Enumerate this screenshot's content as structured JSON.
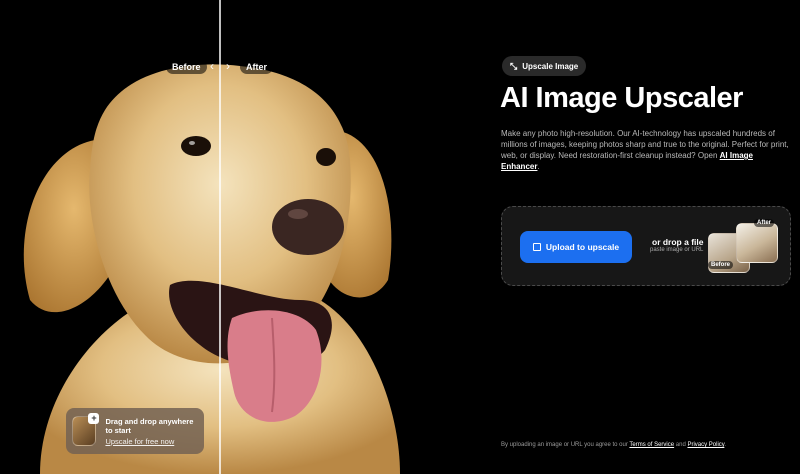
{
  "compare": {
    "before_label": "Before",
    "after_label": "After",
    "handle_left": "‹",
    "handle_right": "›"
  },
  "drop_card": {
    "title": "Drag and drop anywhere to start",
    "link": "Upscale for free now",
    "icon": "image-thumbnail-icon"
  },
  "hero": {
    "tag_label": "Upscale Image",
    "tag_icon": "sparkle-icon",
    "title": "AI Image Upscaler",
    "description": "Make any photo high-resolution. Our AI-technology has upscaled hundreds of millions of images, keeping photos sharp and true to the original. Perfect for print, web, or display. Need restoration-first cleanup instead? Open ",
    "description_link": "AI Image Enhancer",
    "description_end": "."
  },
  "upload": {
    "button_label": "Upload to upscale",
    "or_drop": "or drop a file",
    "paste_hint": "paste image or URL",
    "sample_before": "Before",
    "sample_after": "After"
  },
  "legal": {
    "prefix": "By uploading an image or URL you agree to our ",
    "terms": "Terms of Service",
    "and": " and ",
    "privacy": "Privacy Policy",
    "suffix": "."
  },
  "colors": {
    "background": "#000000",
    "primary_button": "#1c6ff0",
    "upload_box": "#171717"
  }
}
